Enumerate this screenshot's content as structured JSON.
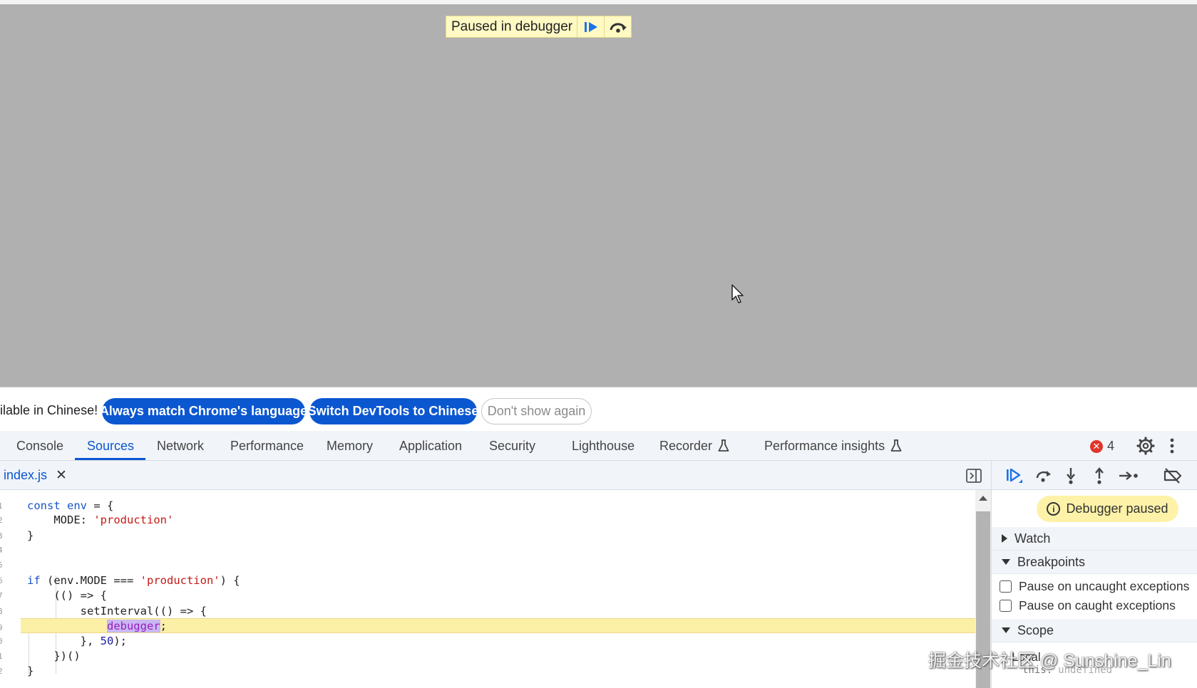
{
  "viewport": {
    "banner_text": "Paused in debugger",
    "resume_icon": "resume-icon",
    "step_over_icon": "step-over-icon",
    "cursor_icon": "mouse-pointer-icon"
  },
  "infobar": {
    "message": "ilable in Chinese!",
    "match_language_label": "Always match Chrome's language",
    "switch_label": "Switch DevTools to Chinese",
    "dont_show_label": "Don't show again",
    "primary_color": "#0b57d0"
  },
  "tabs": {
    "console": "Console",
    "sources": "Sources",
    "network": "Network",
    "performance": "Performance",
    "memory": "Memory",
    "application": "Application",
    "security": "Security",
    "lighthouse": "Lighthouse",
    "recorder": "Recorder",
    "performance_insights": "Performance insights",
    "active": "Sources",
    "error_count": "4"
  },
  "editor": {
    "file_name": "index.js",
    "close_glyph": "✕",
    "line_numbers": [
      "1",
      "2",
      "3",
      "4",
      "5",
      "6",
      "7",
      "8",
      "9",
      "0",
      "1",
      "2"
    ],
    "paused_line": 9
  },
  "debugger": {
    "paused_label": "Debugger paused",
    "watch_label": "Watch",
    "breakpoints_label": "Breakpoints",
    "uncaught_label": "Pause on uncaught exceptions",
    "caught_label": "Pause on caught exceptions",
    "scope_label": "Scope",
    "local_label": "Local",
    "this_label": "this:",
    "this_value": "undefined",
    "accent_color": "#fdf2a8"
  },
  "watermark": "掘金技术社区 @ Sunshine_Lin"
}
